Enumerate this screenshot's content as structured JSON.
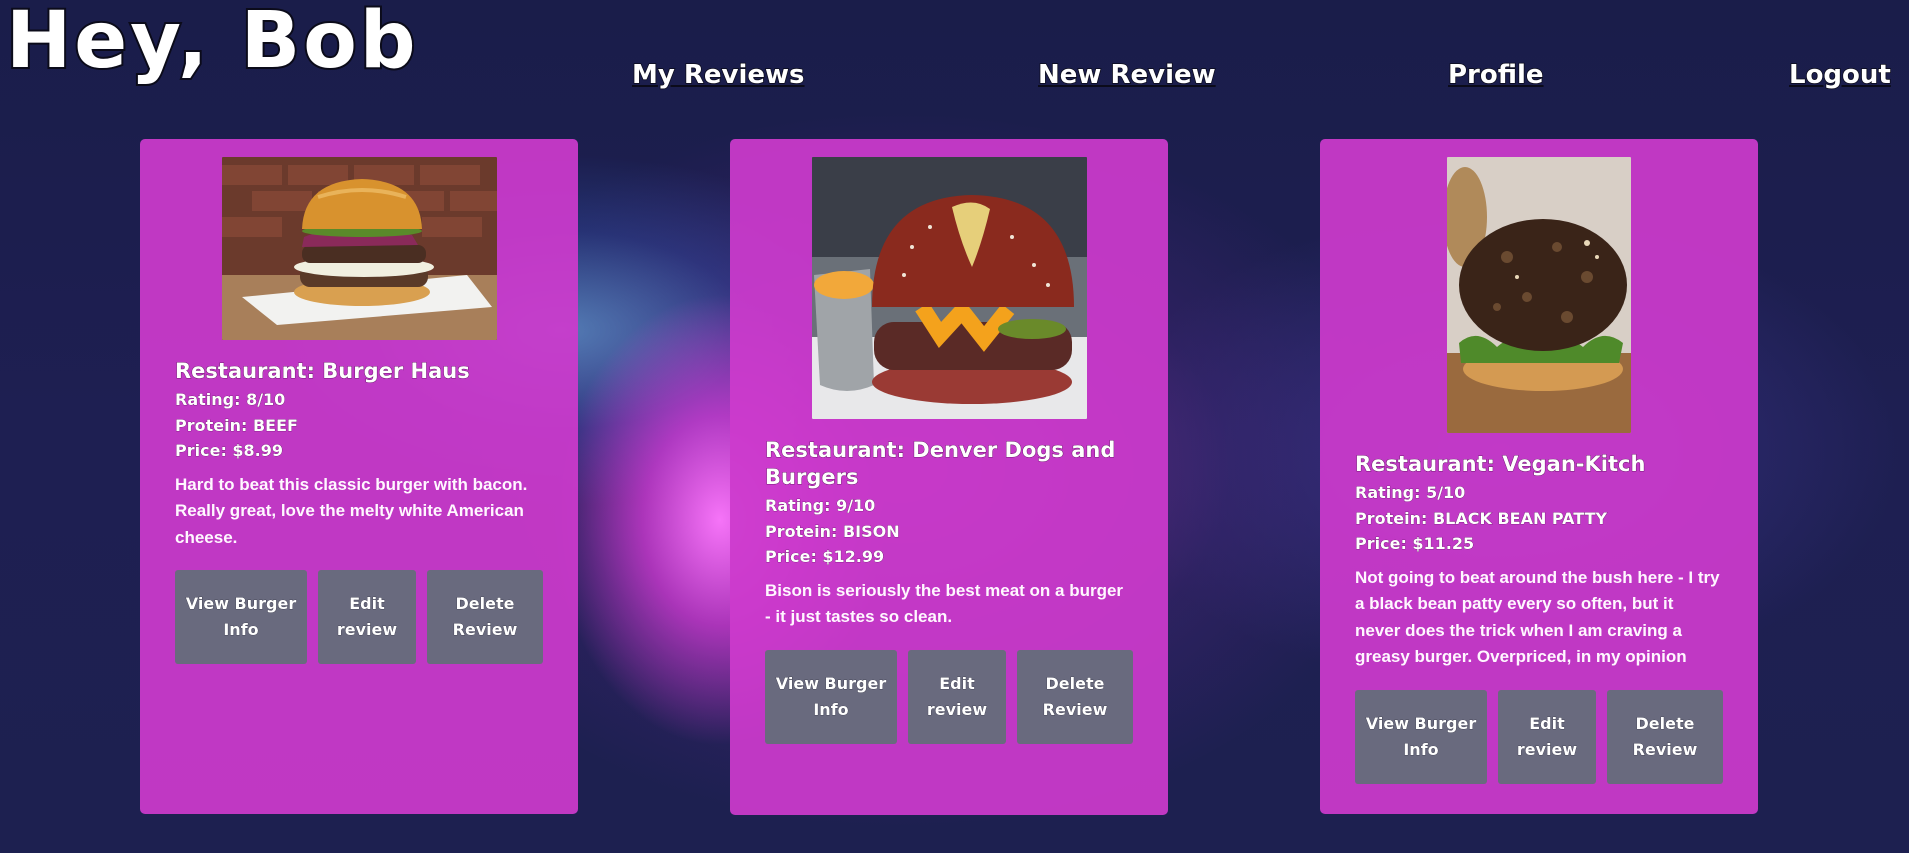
{
  "header": {
    "greeting": "Hey, Bob"
  },
  "nav": {
    "my_reviews": "My Reviews",
    "new_review": "New Review",
    "profile": "Profile",
    "logout": "Logout"
  },
  "reviews": [
    {
      "restaurant": "Restaurant: Burger Haus",
      "rating": "Rating: 8/10",
      "protein": "Protein: BEEF",
      "price": "Price: $8.99",
      "description": "Hard to beat this classic burger with bacon. Really great, love the melty white American cheese.",
      "view_label": "View Burger Info",
      "edit_label": "Edit review",
      "delete_label": "Delete Review"
    },
    {
      "restaurant": "Restaurant: Denver Dogs and Burgers",
      "rating": "Rating: 9/10",
      "protein": "Protein: BISON",
      "price": "Price: $12.99",
      "description": "Bison is seriously the best meat on a burger - it just tastes so clean.",
      "view_label": "View Burger Info",
      "edit_label": "Edit review",
      "delete_label": "Delete Review"
    },
    {
      "restaurant": "Restaurant: Vegan-Kitch",
      "rating": "Rating: 5/10",
      "protein": "Protein: BLACK BEAN PATTY",
      "price": "Price: $11.25",
      "description": "Not going to beat around the bush here - I try a black bean patty every so often, but it never does the trick when I am craving a greasy burger. Overpriced, in my opinion",
      "view_label": "View Burger Info",
      "edit_label": "Edit review",
      "delete_label": "Delete Review"
    }
  ]
}
